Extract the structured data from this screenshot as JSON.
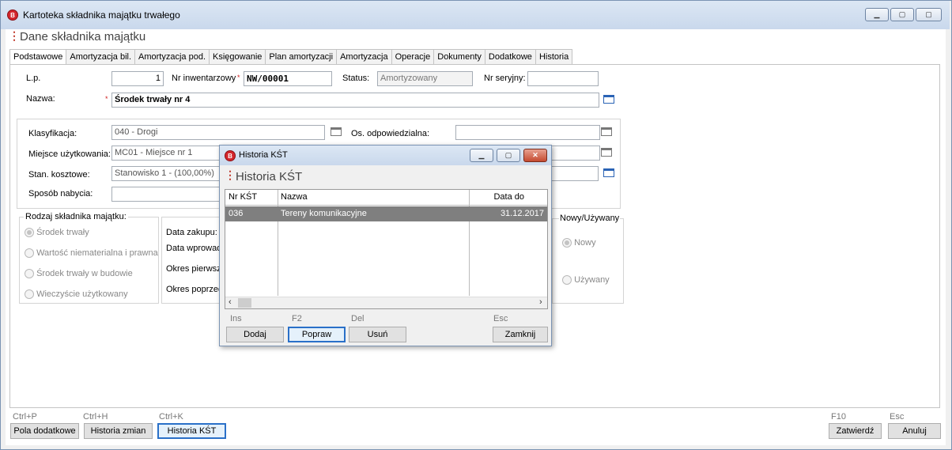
{
  "window": {
    "title": "Kartoteka składnika majątku trwałego",
    "icon_letter": "B",
    "header": "Dane składnika majątku"
  },
  "tabs": [
    "Podstawowe",
    "Amortyzacja bil.",
    "Amortyzacja pod.",
    "Księgowanie",
    "Plan amortyzacji",
    "Amortyzacja",
    "Operacje",
    "Dokumenty",
    "Dodatkowe",
    "Historia"
  ],
  "form": {
    "lp_label": "L.p.",
    "lp_value": "1",
    "inv_label": "Nr inwentarzowy",
    "inv_value": "NW/00001",
    "status_label": "Status:",
    "status_value": "Amortyzowany",
    "serial_label": "Nr seryjny:",
    "serial_value": "",
    "name_label": "Nazwa:",
    "name_value": "Środek trwały nr 4",
    "klas_label": "Klasyfikacja:",
    "klas_value": "040 - Drogi",
    "os_label": "Os. odpowiedzialna:",
    "os_value": "",
    "miejsce_label": "Miejsce użytkowania:",
    "miejsce_value": "MC01 - Miejsce nr 1",
    "stan_label": "Stan. kosztowe:",
    "stan_value": "Stanowisko 1 -  (100,00%)",
    "sposob_label": "Sposób nabycia:",
    "sposob_value": ""
  },
  "rodzaj": {
    "title": "Rodzaj składnika majątku:",
    "options": [
      "Środek trwały",
      "Wartość niematerialna i prawna",
      "Środek trwały w budowie",
      "Wieczyście użytkowany"
    ]
  },
  "dates": {
    "zakup": "Data zakupu:",
    "wprowadz": "Data wprowad",
    "okres1": "Okres pierwsz",
    "okres2": "Okres poprzed"
  },
  "nowy": {
    "title": "Nowy/Używany",
    "options": [
      "Nowy",
      "Używany"
    ]
  },
  "bottom": {
    "pola_key": "Ctrl+P",
    "pola": "Pola dodatkowe",
    "hist_key": "Ctrl+H",
    "hist": "Historia zmian",
    "kst_key": "Ctrl+K",
    "kst": "Historia KŚT",
    "ok_key": "F10",
    "ok": "Zatwierdź",
    "cancel_key": "Esc",
    "cancel": "Anuluj"
  },
  "dialog": {
    "title": "Historia KŚT",
    "header": "Historia KŚT",
    "columns": [
      "Nr KŚT",
      "Nazwa",
      "Data do"
    ],
    "rows": [
      {
        "nr": "036",
        "nazwa": "Tereny komunikacyjne",
        "data": "31.12.2017"
      }
    ],
    "add_key": "Ins",
    "add": "Dodaj",
    "edit_key": "F2",
    "edit": "Popraw",
    "del_key": "Del",
    "del": "Usuń",
    "close_key": "Esc",
    "close": "Zamknij"
  }
}
